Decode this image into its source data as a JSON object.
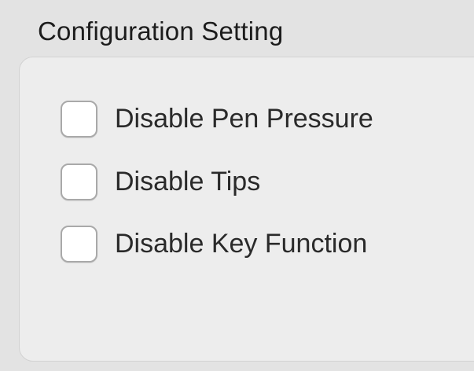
{
  "section": {
    "title": "Configuration Setting"
  },
  "options": [
    {
      "label": "Disable Pen Pressure",
      "checked": false
    },
    {
      "label": "Disable Tips",
      "checked": false
    },
    {
      "label": "Disable Key Function",
      "checked": false
    }
  ],
  "colors": {
    "window_background": "#e3e3e3",
    "group_background": "#ededed",
    "checkbox_fill": "#ffffff",
    "checkbox_border": "#a9a9a9",
    "text": "#2a2a2a"
  }
}
